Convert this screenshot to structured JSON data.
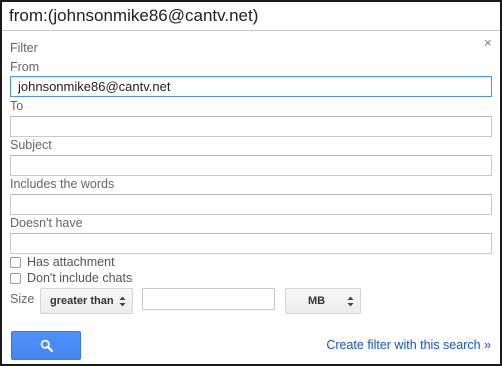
{
  "search_bar": {
    "query": "from:(johnsonmike86@cantv.net)"
  },
  "filter": {
    "title": "Filter",
    "close_glyph": "×",
    "from": {
      "label": "From",
      "value": "johnsonmike86@cantv.net"
    },
    "to": {
      "label": "To",
      "value": ""
    },
    "subject": {
      "label": "Subject",
      "value": ""
    },
    "includes": {
      "label": "Includes the words",
      "value": ""
    },
    "doesnt_have": {
      "label": "Doesn't have",
      "value": ""
    },
    "has_attachment": {
      "label": "Has attachment",
      "checked": false
    },
    "dont_include_chats": {
      "label": "Don't include chats",
      "checked": false
    },
    "size": {
      "label": "Size",
      "comparator": "greater than",
      "value": "",
      "unit": "MB"
    },
    "search_button": {
      "icon": "search-icon"
    },
    "create_filter_link": "Create filter with this search »"
  },
  "colors": {
    "accent": "#4d90fe",
    "link": "#1155cc",
    "border": "#c9c9c9"
  }
}
